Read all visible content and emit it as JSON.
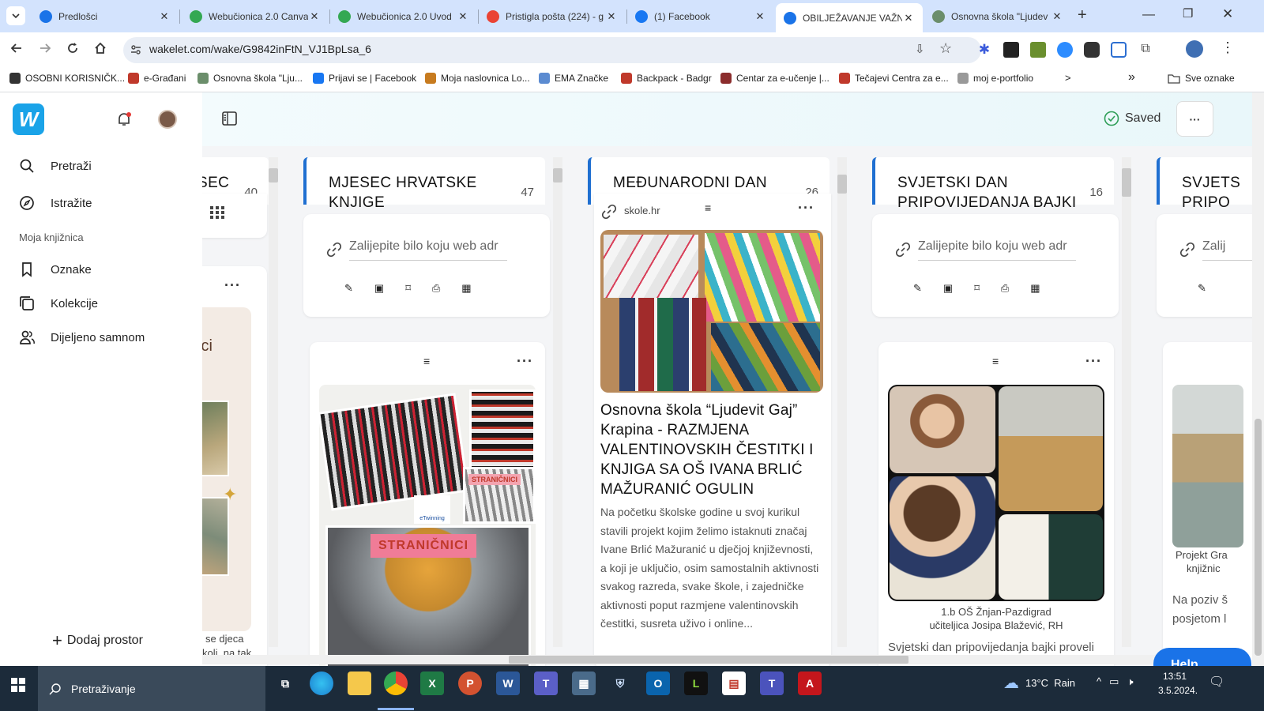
{
  "browser": {
    "tabs": [
      {
        "title": "Predlošci",
        "favicon": "canva-icon",
        "color": "#1a73e8",
        "active": false
      },
      {
        "title": "Webučionica 2.0 Canva",
        "favicon": "drive-icon",
        "color": "#34a853",
        "active": false
      },
      {
        "title": "Webučionica 2.0 Uvod",
        "favicon": "drive-icon",
        "color": "#34a853",
        "active": false
      },
      {
        "title": "Pristigla pošta (224) - g",
        "favicon": "gmail-icon",
        "color": "#ea4335",
        "active": false
      },
      {
        "title": "(1) Facebook",
        "favicon": "facebook-icon",
        "color": "#1877f2",
        "active": false
      },
      {
        "title": "OBILJEŽAVANJE VAŽNI",
        "favicon": "wakelet-icon",
        "color": "#1a73e8",
        "active": true
      },
      {
        "title": "Osnovna škola \"Ljudev",
        "favicon": "school-shield-icon",
        "color": "#6b8e6b",
        "active": false
      }
    ],
    "url": "wakelet.com/wake/G9842inFtN_VJ1BpLsa_6",
    "bookmarks": [
      {
        "label": "OSOBNI KORISNIČK...",
        "color": "#333"
      },
      {
        "label": "e-Građani",
        "color": "#c0392b"
      },
      {
        "label": "Osnovna škola \"Lju...",
        "color": "#6b8e6b"
      },
      {
        "label": "Prijavi se | Facebook",
        "color": "#1877f2"
      },
      {
        "label": "Moja naslovnica Lo...",
        "color": "#c77b1f"
      },
      {
        "label": "EMA Značke",
        "color": "#5b8bd1"
      },
      {
        "label": "Backpack - Badgr",
        "color": "#c0392b"
      },
      {
        "label": "Centar za e-učenje |...",
        "color": "#8b2d2d"
      },
      {
        "label": "Tečajevi Centra za e...",
        "color": "#c0392b"
      },
      {
        "label": "moj e-portfolio",
        "color": "#999"
      }
    ],
    "all_bookmarks_label": "Sve oznake",
    "more_bookmarks": ">",
    "overflow": "»"
  },
  "sidebar": {
    "logo": "W",
    "items": [
      {
        "label": "Pretraži",
        "icon": "search-icon"
      },
      {
        "label": "Istražite",
        "icon": "compass-icon"
      }
    ],
    "library_heading": "Moja knjižnica",
    "library_items": [
      {
        "label": "Oznake",
        "icon": "bookmark-icon"
      },
      {
        "label": "Kolekcije",
        "icon": "collections-icon"
      },
      {
        "label": "Dijeljeno samnom",
        "icon": "shared-users-icon"
      }
    ],
    "add_space": "Dodaj prostor"
  },
  "header": {
    "saved_label": "Saved",
    "more": "···"
  },
  "columns": [
    {
      "title": "SEC\nA",
      "count": "40"
    },
    {
      "title": "MJESEC HRVATSKE\nKNJIGE",
      "count": "47"
    },
    {
      "title": "MEĐUNARODNI DAN\nDARIVANJA KNJIGA",
      "count": "26"
    },
    {
      "title": "SVJETSKI DAN\nPRIPOVIJEDANJA BAJKI",
      "count": "16"
    },
    {
      "title": "SVJETS\nPRIPO",
      "count": ""
    }
  ],
  "paste_placeholder": "Zalijepite bilo koju web adr",
  "paste_placeholder_cut": "Zalij",
  "left_partial": {
    "card_title_fragment": "ici",
    "caption_fragment_1": "se djeca",
    "caption_fragment_2": "koli, na tak"
  },
  "link_card": {
    "source": "skole.hr",
    "title": "Osnovna škola “Ljudevit Gaj” Krapina - RAZMJENA VALENTINOVSKIH ČESTITKI I KNJIGA SA OŠ IVANA BRLIĆ MAŽURANIĆ OGULIN",
    "description": "Na početku školske godine u svoj kurikul stavili projekt kojim želimo istaknuti značaj Ivane Brlić Mažuranić u dječjoj književnosti, a koji je uključio, osim samostalnih aktivnosti svakog razreda, svake škole, i zajedničke aktivnosti poput razmjene valentinovskih čestitki, susreta uživo i online..."
  },
  "bookmark_card": {
    "image_text_1": "STRANIČNICI",
    "image_text_2": "STRANIČNICI",
    "image_text_3": "eTwinning"
  },
  "fairy_card": {
    "caption_line1": "1.b OŠ Žnjan-Pazdigrad",
    "caption_line2": "učiteljica Josipa Blažević, RH",
    "text": "Svjetski dan pripovijedanja bajki proveli"
  },
  "right_partial": {
    "caption1": "Projekt Gra",
    "caption2": "knjižnic",
    "text1": "Na poziv š",
    "text2": "posjetom l"
  },
  "help_label": "Help",
  "taskbar": {
    "search": "Pretraživanje",
    "weather": "13°C  Rain",
    "time": "13:51",
    "date": "3.5.2024."
  }
}
